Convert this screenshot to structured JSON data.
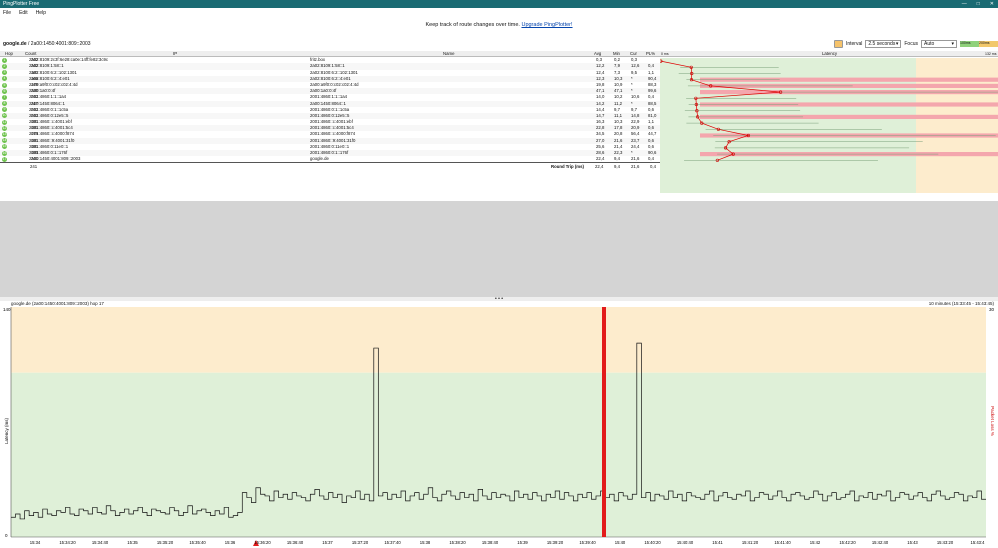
{
  "app": {
    "title": "PingPlotter Free",
    "menu": [
      "File",
      "Edit",
      "Help"
    ],
    "win_min": "—",
    "win_max": "□",
    "win_close": "✕"
  },
  "banner": {
    "text": "Keep track of route changes over time.",
    "link": "Upgrade PingPlotter!"
  },
  "target": {
    "host": "google.de",
    "address": "/ 2a00:1450:4001:809::2003"
  },
  "controls": {
    "interval_label": "Interval",
    "interval": "2.5 seconds",
    "focus_label": "Focus",
    "focus": "Auto",
    "scale": [
      "100ms",
      "200ms"
    ]
  },
  "columns": {
    "hop": "Hop",
    "count": "Count",
    "ip": "IP",
    "name": "Name",
    "avg": "Avg",
    "min": "Min",
    "cur": "Cur",
    "pl": "PL%",
    "latency": "Latency",
    "lat0": "0 ms",
    "latmax": "132 ms"
  },
  "rows": [
    {
      "hop": "1",
      "count": "242",
      "ip": "2a02:8109:2c3f:6e28:ca0e:14ff:fe82:3c9c",
      "name": "fritz.box",
      "avg": "0,3",
      "min": "0,2",
      "cur": "0,3",
      "pl": ""
    },
    {
      "hop": "2",
      "count": "242",
      "ip": "2a02:8109:1:58::1",
      "name": "2a02:8109:1:58::1",
      "avg": "12,2",
      "min": "7,9",
      "cur": "12,6",
      "pl": "0,4"
    },
    {
      "hop": "3",
      "count": "181",
      "ip": "2a02:8100:6:2::102:1301",
      "name": "2a02:8100:6:2::102:1301",
      "avg": "12,4",
      "min": "7,3",
      "cur": "9,5",
      "pl": "1,1"
    },
    {
      "hop": "4",
      "count": "166",
      "ip": "2a02:8100:6:2::4:e01",
      "name": "2a02:8100:6:2::4:e01",
      "avg": "12,3",
      "min": "10,3",
      "cur": "*",
      "pl": "90,4"
    },
    {
      "hop": "5",
      "count": "179",
      "ip": "2a00:a9f0:0:c02:c02:4:4d",
      "name": "2a00:a9f0:0:c02:c02:4:4d",
      "avg": "19,8",
      "min": "10,9",
      "cur": "*",
      "pl": "88,3"
    },
    {
      "hop": "6",
      "count": "230",
      "ip": "2a00:1a0:0:4f",
      "name": "2a00:1a0:0:4f",
      "avg": "47,1",
      "min": "47,1",
      "cur": "*",
      "pl": "99,6"
    },
    {
      "hop": "7",
      "count": "242",
      "ip": "2001:4860:1:1::1a4",
      "name": "2001:4860:1:1::1a4",
      "avg": "14,0",
      "min": "10,2",
      "cur": "10,6",
      "pl": "0,4"
    },
    {
      "hop": "8",
      "count": "217",
      "ip": "2a00:1450:8064::1",
      "name": "2a00:1450:8064::1",
      "avg": "14,2",
      "min": "11,2",
      "cur": "*",
      "pl": "88,5"
    },
    {
      "hop": "9",
      "count": "242",
      "ip": "2001:4860:0:1::1c5a",
      "name": "2001:4860:0:1::1c5a",
      "avg": "14,4",
      "min": "9,7",
      "cur": "9,7",
      "pl": "0,6"
    },
    {
      "hop": "10",
      "count": "242",
      "ip": "2001:4860:0:12e5::5",
      "name": "2001:4860:0:12e5::5",
      "avg": "14,7",
      "min": "11,1",
      "cur": "14,8",
      "pl": "81,0"
    },
    {
      "hop": "11",
      "count": "181",
      "ip": "2001:4860::c:4001:ebf",
      "name": "2001:4860::c:4001:ebf",
      "avg": "16,3",
      "min": "10,3",
      "cur": "22,9",
      "pl": "1,1"
    },
    {
      "hop": "12",
      "count": "181",
      "ip": "2001:4860::c:4001:5c4",
      "name": "2001:4860::c:4001:5c4",
      "avg": "22,8",
      "min": "17,8",
      "cur": "20,9",
      "pl": "0,6"
    },
    {
      "hop": "13",
      "count": "179",
      "ip": "2001:4860::c:4000:f874",
      "name": "2001:4860::c:4000:f874",
      "avg": "34,5",
      "min": "20,8",
      "cur": "56,4",
      "pl": "44,7"
    },
    {
      "hop": "14",
      "count": "181",
      "ip": "2001:4860::9:4001:31f0",
      "name": "2001:4860::9:4001:31f0",
      "avg": "27,0",
      "min": "21,6",
      "cur": "23,7",
      "pl": "0,6"
    },
    {
      "hop": "15",
      "count": "181",
      "ip": "2001:4860:0:11e0::1",
      "name": "2001:4860:0:11e0::1",
      "avg": "25,6",
      "min": "21,4",
      "cur": "24,4",
      "pl": "0,6"
    },
    {
      "hop": "16",
      "count": "180",
      "ip": "2001:4860:0:1::176f",
      "name": "2001:4860:0:1::176f",
      "avg": "28,6",
      "min": "22,3",
      "cur": "*",
      "pl": "90,6"
    },
    {
      "hop": "17",
      "count": "241",
      "ip": "2a00:1450:4001:809::2003",
      "name": "google.de",
      "avg": "22,4",
      "min": "9,4",
      "cur": "21,6",
      "pl": "0,4"
    }
  ],
  "footer": {
    "count": "241",
    "label": "Round Trip (ms)",
    "avg": "22,4",
    "min": "9,4",
    "cur": "21,6",
    "pl": "0,4",
    "focus": "Focus: 15:33:45 - 15:43:45"
  },
  "bottom": {
    "title": "google.de (2a00:1450:4001:809::2003) hop 17",
    "range": "10 minutes (15:33:45 - 15:43:45)",
    "ylabel": "Latency (ms)",
    "y2label": "Packet Loss %",
    "ymax": "140",
    "ymin": "0",
    "y2max": "30",
    "ticks": [
      "15:34",
      "15:34:20",
      "15:34:40",
      "15:35",
      "15:35:20",
      "15:35:40",
      "15:36",
      "15:36:20",
      "15:36:40",
      "15:37",
      "15:37:20",
      "15:37:40",
      "15:38",
      "15:38:20",
      "15:38:40",
      "15:39",
      "15:39:20",
      "15:39:40",
      "15:40",
      "15:40:20",
      "15:40:40",
      "15:41",
      "15:41:20",
      "15:41:40",
      "15:42",
      "15:42:20",
      "15:42:40",
      "15:43",
      "15:43:20",
      "15:43:4"
    ]
  },
  "chart_data": {
    "type": "line",
    "title": "google.de (2a00:1450:4001:809::2003) hop 17",
    "ylabel": "Latency (ms)",
    "ylim": [
      0,
      140
    ],
    "series": [
      {
        "name": "Latency",
        "values": [
          12,
          14,
          11,
          16,
          13,
          15,
          12,
          17,
          14,
          13,
          16,
          15,
          18,
          14,
          13,
          17,
          16,
          14,
          18,
          15,
          14,
          19,
          16,
          13,
          15,
          17,
          14,
          16,
          18,
          15,
          13,
          17,
          16,
          15,
          14,
          18,
          16,
          13,
          15,
          19,
          14,
          16,
          17,
          15,
          13,
          16,
          14,
          18,
          12,
          13,
          15,
          27,
          24,
          21,
          30,
          26,
          25,
          22,
          28,
          24,
          26,
          23,
          27,
          25,
          24,
          22,
          26,
          29,
          25,
          23,
          27,
          24,
          26,
          21,
          25,
          24,
          28,
          23,
          26,
          22,
          115,
          25,
          27,
          23,
          26,
          24,
          28,
          22,
          25,
          27,
          23,
          26,
          30,
          24,
          22,
          26,
          28,
          25,
          23,
          27,
          24,
          26,
          22,
          29,
          25,
          23,
          27,
          24,
          26,
          25,
          22,
          28,
          24,
          26,
          23,
          27,
          25,
          22,
          26,
          24,
          28,
          23,
          27,
          25,
          22,
          26,
          24,
          27,
          23,
          25,
          28,
          24,
          26,
          22,
          27,
          25,
          23,
          26,
          118,
          24,
          27,
          22,
          26,
          25,
          23,
          28,
          24,
          26,
          22,
          27,
          25,
          24,
          23,
          26,
          28,
          22,
          25,
          27,
          24,
          23,
          26,
          25,
          28,
          22,
          24,
          27,
          26,
          23,
          25,
          28,
          24,
          22,
          26,
          27,
          25,
          23,
          24,
          28,
          26,
          22,
          25,
          27,
          23,
          24,
          26,
          28,
          22,
          25,
          24,
          27,
          23,
          26,
          25,
          28,
          22,
          24,
          27,
          26,
          23,
          25,
          27,
          24,
          22,
          26,
          28,
          25,
          23,
          24,
          27,
          26,
          22,
          25,
          24,
          28,
          23
        ]
      }
    ]
  }
}
